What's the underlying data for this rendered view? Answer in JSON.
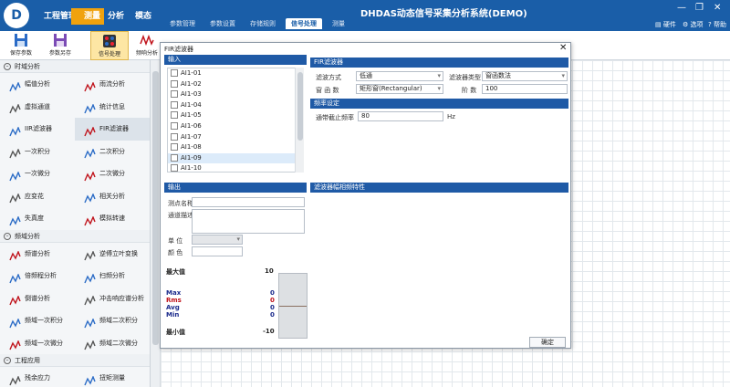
{
  "app": {
    "title": "DHDAS动态信号采集分析系统(DEMO)",
    "breadcrumbs": [
      {
        "label": "工程管理",
        "active": false
      },
      {
        "label": "测量",
        "active": true
      },
      {
        "label": "分析",
        "active": false
      },
      {
        "label": "模态",
        "active": false
      }
    ],
    "subnav": [
      {
        "label": "参数管理",
        "active": false
      },
      {
        "label": "参数设置",
        "active": false
      },
      {
        "label": "存储规则",
        "active": false
      },
      {
        "label": "信号处理",
        "active": true
      },
      {
        "label": "测量",
        "active": false
      }
    ],
    "header_right": {
      "hardware": "硬件",
      "options": "选项",
      "help": "帮助"
    }
  },
  "ribbon": {
    "buttons": [
      {
        "label": "保存参数",
        "icon": "save-icon",
        "active": false
      },
      {
        "label": "参数另存",
        "icon": "save-as-icon",
        "active": false
      },
      {
        "label": "信号处理",
        "icon": "signal-process-icon",
        "active": true
      },
      {
        "label": "频响分析",
        "icon": "frequency-response-icon",
        "active": false
      }
    ]
  },
  "sidebar": {
    "sections": [
      {
        "title": "时域分析",
        "items": [
          {
            "label": "幅值分析",
            "icon": "amplitude-icon",
            "selected": false
          },
          {
            "label": "雨流分析",
            "icon": "rainflow-icon",
            "selected": false
          },
          {
            "label": "虚拟通道",
            "icon": "virtual-channel-icon",
            "selected": false
          },
          {
            "label": "统计信息",
            "icon": "statistics-icon",
            "selected": false
          },
          {
            "label": "IIR滤波器",
            "icon": "iir-filter-icon",
            "selected": false
          },
          {
            "label": "FIR滤波器",
            "icon": "fir-filter-icon",
            "selected": true
          },
          {
            "label": "一次积分",
            "icon": "integral-icon",
            "selected": false
          },
          {
            "label": "二次积分",
            "icon": "double-integral-icon",
            "selected": false
          },
          {
            "label": "一次微分",
            "icon": "derivative-icon",
            "selected": false
          },
          {
            "label": "二次微分",
            "icon": "double-derivative-icon",
            "selected": false
          },
          {
            "label": "应变花",
            "icon": "strain-rosette-icon",
            "selected": false
          },
          {
            "label": "相关分析",
            "icon": "correlation-icon",
            "selected": false
          },
          {
            "label": "失真度",
            "icon": "distortion-icon",
            "selected": false
          },
          {
            "label": "模拟转速",
            "icon": "tachometer-icon",
            "selected": false
          }
        ]
      },
      {
        "title": "频域分析",
        "items": [
          {
            "label": "频谱分析",
            "icon": "spectrum-icon",
            "selected": false
          },
          {
            "label": "逆傅立叶变换",
            "icon": "inverse-fft-icon",
            "selected": false
          },
          {
            "label": "倍频程分析",
            "icon": "octave-icon",
            "selected": false
          },
          {
            "label": "扫频分析",
            "icon": "sweep-icon",
            "selected": false
          },
          {
            "label": "倒谱分析",
            "icon": "cepstrum-icon",
            "selected": false
          },
          {
            "label": "冲击响应谱分析",
            "icon": "shock-response-icon",
            "selected": false
          },
          {
            "label": "频域一次积分",
            "icon": "freq-integral-icon",
            "selected": false
          },
          {
            "label": "频域二次积分",
            "icon": "freq-double-integral-icon",
            "selected": false
          },
          {
            "label": "频域一次微分",
            "icon": "freq-derivative-icon",
            "selected": false
          },
          {
            "label": "频域二次微分",
            "icon": "freq-double-derivative-icon",
            "selected": false
          }
        ]
      },
      {
        "title": "工程应用",
        "items": [
          {
            "label": "残余应力",
            "icon": "residual-stress-icon",
            "selected": false
          },
          {
            "label": "扭矩测量",
            "icon": "torque-icon",
            "selected": false
          }
        ]
      }
    ]
  },
  "dialog": {
    "title": "FIR滤波器",
    "input_header": "输入",
    "channels": [
      "AI1-01",
      "AI1-02",
      "AI1-03",
      "AI1-04",
      "AI1-05",
      "AI1-06",
      "AI1-07",
      "AI1-08",
      "AI1-09",
      "AI1-10"
    ],
    "current_channel": "AI1-09",
    "filter_header": "FIR滤波器",
    "filter_mode_label": "滤波方式",
    "filter_mode_value": "低通",
    "filter_type_label": "滤波器类型",
    "filter_type_value": "窗函数法",
    "window_label": "窗 函 数",
    "window_value": "矩形窗(Rectangular)",
    "order_label": "阶  数",
    "order_value": "100",
    "freq_header": "频率设定",
    "cutoff_label": "通带截止频率",
    "cutoff_value": "80",
    "cutoff_unit": "Hz",
    "output_header": "输出",
    "point_name_label": "测点名称",
    "point_name_value": "",
    "channel_desc_label": "通道描述",
    "channel_desc_value": "",
    "unit_label": "单   位",
    "unit_value": "",
    "color_label": "颜   色",
    "response_header": "滤波器幅相频特性",
    "max_label": "最大值",
    "max_value": "10",
    "min_label": "最小值",
    "min_value": "-10",
    "stats": [
      {
        "label": "Max",
        "value": "0",
        "color": "#1a2a8c"
      },
      {
        "label": "Rms",
        "value": "0",
        "color": "#c0141c"
      },
      {
        "label": "Avg",
        "value": "0",
        "color": "#1a2a8c"
      },
      {
        "label": "Min",
        "value": "0",
        "color": "#1a2a8c"
      }
    ],
    "ok_label": "确定"
  },
  "colors": {
    "accent": "#1a5ea8",
    "active_tab": "#f0a20e",
    "panel_header": "#1f5aa6"
  }
}
